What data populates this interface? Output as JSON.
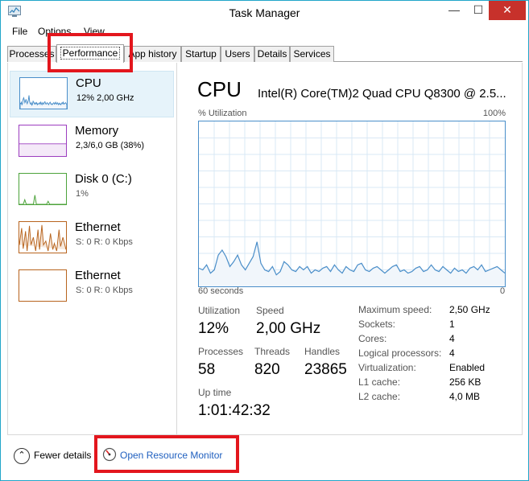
{
  "window": {
    "title": "Task Manager",
    "minimize": "—",
    "maximize": "☐",
    "close": "✕"
  },
  "menu": {
    "file": "File",
    "options": "Options",
    "view": "View"
  },
  "tabs": [
    "Processes",
    "Performance",
    "App history",
    "Startup",
    "Users",
    "Details",
    "Services"
  ],
  "sidebar": {
    "items": [
      {
        "name": "CPU",
        "sub": "12% 2,00 GHz",
        "color": "#4a8ec9"
      },
      {
        "name": "Memory",
        "sub": "2,3/6,0 GB (38%)",
        "color": "#9c3dbf"
      },
      {
        "name": "Disk 0 (C:)",
        "sub": "1%",
        "color": "#4da33b"
      },
      {
        "name": "Ethernet",
        "sub": "S: 0 R: 0 Kbps",
        "color": "#b8641e"
      },
      {
        "name": "Ethernet",
        "sub": "S: 0 R: 0 Kbps",
        "color": "#b8641e"
      }
    ]
  },
  "cpu": {
    "title": "CPU",
    "model": "Intel(R) Core(TM)2 Quad CPU Q8300 @ 2.5...",
    "util_label": "% Utilization",
    "max_label": "100%",
    "time_label": "60 seconds",
    "zero_label": "0",
    "graph_values": [
      11,
      10,
      13,
      8,
      10,
      19,
      22,
      18,
      12,
      15,
      19,
      13,
      10,
      14,
      18,
      27,
      14,
      10,
      9,
      12,
      7,
      9,
      15,
      13,
      10,
      9,
      12,
      10,
      12,
      8,
      10,
      9,
      11,
      12,
      9,
      13,
      10,
      8,
      12,
      10,
      9,
      13,
      14,
      10,
      9,
      11,
      12,
      10,
      8,
      10,
      12,
      13,
      9,
      10,
      8,
      9,
      11,
      12,
      9,
      10,
      13,
      10,
      9,
      12,
      10,
      8,
      11,
      9,
      10,
      8,
      11,
      12,
      10,
      13,
      9,
      10,
      11,
      12,
      10,
      8
    ]
  },
  "stats": {
    "utilization_label": "Utilization",
    "utilization": "12%",
    "speed_label": "Speed",
    "speed": "2,00 GHz",
    "processes_label": "Processes",
    "processes": "58",
    "threads_label": "Threads",
    "threads": "820",
    "handles_label": "Handles",
    "handles": "23865",
    "uptime_label": "Up time",
    "uptime": "1:01:42:32"
  },
  "details": [
    {
      "label": "Maximum speed:",
      "value": "2,50 GHz"
    },
    {
      "label": "Sockets:",
      "value": "1"
    },
    {
      "label": "Cores:",
      "value": "4"
    },
    {
      "label": "Logical processors:",
      "value": "4"
    },
    {
      "label": "Virtualization:",
      "value": "Enabled"
    },
    {
      "label": "L1 cache:",
      "value": "256 KB"
    },
    {
      "label": "L2 cache:",
      "value": "4,0 MB"
    }
  ],
  "footer": {
    "fewer": "Fewer details",
    "resource_monitor": "Open Resource Monitor"
  },
  "colors": {
    "highlight": "#e3161d",
    "graph_line": "#4a8ec9",
    "graph_fill": "#f1f6fb"
  }
}
